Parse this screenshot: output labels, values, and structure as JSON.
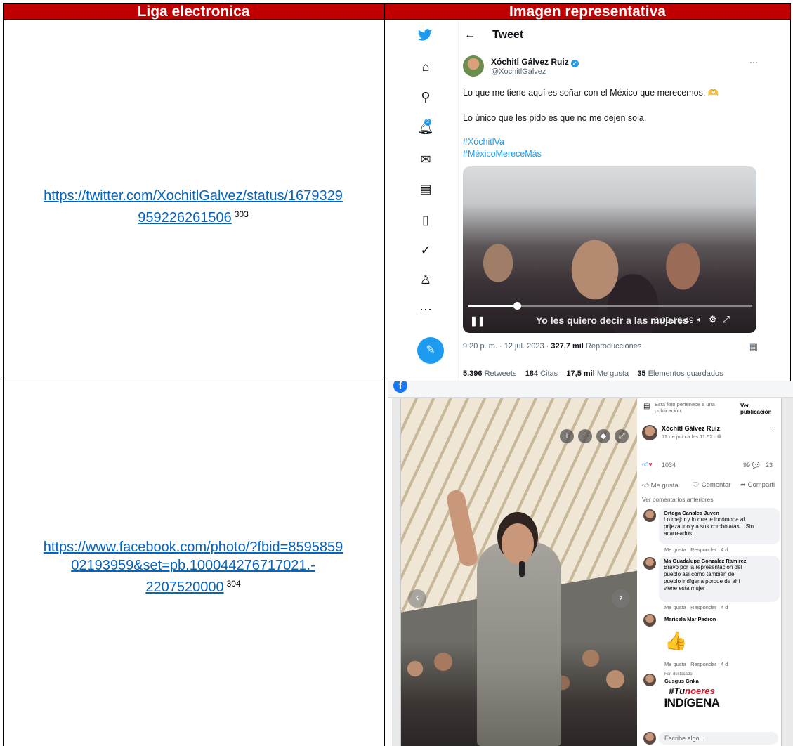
{
  "table": {
    "headers": [
      "Liga electronica",
      "Imagen representativa"
    ],
    "rows": [
      {
        "link_line1": "https://twitter.com/XochitlGalvez/status/1679329",
        "link_line2": "959226261506",
        "footnote": "303"
      },
      {
        "link_line1": "https://www.facebook.com/photo/?fbid=8595859",
        "link_line2": "02193959&set=pb.100044276717021.-",
        "link_line3": "2207520000",
        "footnote": "304"
      }
    ]
  },
  "tweet": {
    "header": "Tweet",
    "author_name": "Xóchitl Gálvez Ruiz",
    "author_handle": "@XochitlGalvez",
    "text1": "Lo que me tiene aquí es soñar con el México que merecemos. 🫶",
    "text2": "Lo único que les pido es que no me dejen sola.",
    "hashtag1": "#XóchitlVa",
    "hashtag2": "#MéxicoMereceMás",
    "video_caption": "Yo les quiero decir a las mujeres",
    "video_time": "0:08 / 0:49",
    "video_progress": 0.17,
    "meta_time": "9:20 p. m. · 12 jul. 2023 · ",
    "views": "327,7 mil",
    "views_label": " Reproducciones",
    "retweets": "5.396",
    "retweets_label": " Retweets",
    "quotes": "184",
    "quotes_label": " Citas",
    "likes": "17,5 mil",
    "likes_label": " Me gusta",
    "bookmarks": "35",
    "bookmarks_label": " Elementos guardados",
    "notification_count": "2",
    "accent_color": "#1d9bf0"
  },
  "facebook": {
    "photo_notice": "Esta foto pertenece a una publicación.",
    "view_post": "Ver publicación",
    "author_name": "Xóchitl Gálvez Ruiz",
    "post_date": "12 de julio a las 11:52 · ",
    "reactions_count": "1034",
    "comments_count": "99 💬",
    "shares_count": "23",
    "like_btn": "Me gusta",
    "comment_btn": "Comentar",
    "share_btn": "Comparti",
    "view_previous": "Ver comentarios anteriores",
    "comments": [
      {
        "name": "Ortega Canales Juven",
        "text": "Lo mejor y lo que le incómoda al prijezaurio y a sus corcholatas... Sin acarreados...",
        "meta": "Me gusta   Responder   4 d"
      },
      {
        "name": "Ma Guadalupe Gonzalez Ramirez",
        "text": "Bravo por la representación del pueblo así como también del pueblo indígena porque de ahí viene esta mujer",
        "meta": "Me gusta   Responder   4 d"
      },
      {
        "name": "Marisela Mar Padron",
        "text": "",
        "meta": "Me gusta   Responder   4 d"
      },
      {
        "name": "Gusgus Gnka",
        "badge": "Fan destacado",
        "text": ""
      }
    ],
    "hash_line1_a": "#Tu",
    "hash_line1_b": "noeres",
    "hash_line2": "INDíGENA",
    "write_placeholder": "Escribe algo...",
    "accent_color": "#1877f2"
  }
}
